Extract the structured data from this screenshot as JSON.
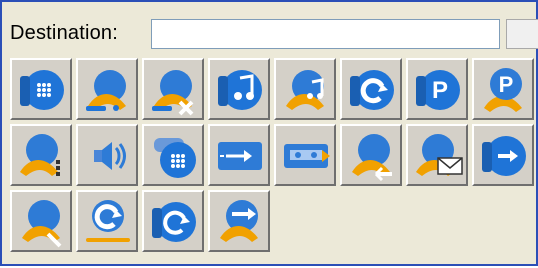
{
  "destination": {
    "label": "Destination:",
    "value": "",
    "placeholder": ""
  },
  "tool_buttons": [
    [
      "phone-dialpad-icon",
      "call-person-icon",
      "call-person-transfer-icon",
      "phone-music-icon",
      "call-music-icon",
      "phone-redial-icon",
      "phone-park-icon",
      "park-call-icon"
    ],
    [
      "call-list-icon",
      "speaker-volume-icon",
      "phone-stack-dialpad-icon",
      "forward-message-icon",
      "cassette-voicemail-icon",
      "call-incoming-icon",
      "call-email-icon",
      "phone-forward-icon"
    ],
    [
      "call-conference-icon",
      "redial-cycle-icon",
      "phone-refresh-icon",
      "call-arrow-icon"
    ]
  ],
  "colors": {
    "border": "#2b4fb7",
    "panel": "#ece9d8",
    "button": "#d4d0c8",
    "icon_blue": "#2e7bd6",
    "icon_orange": "#f1a100"
  }
}
